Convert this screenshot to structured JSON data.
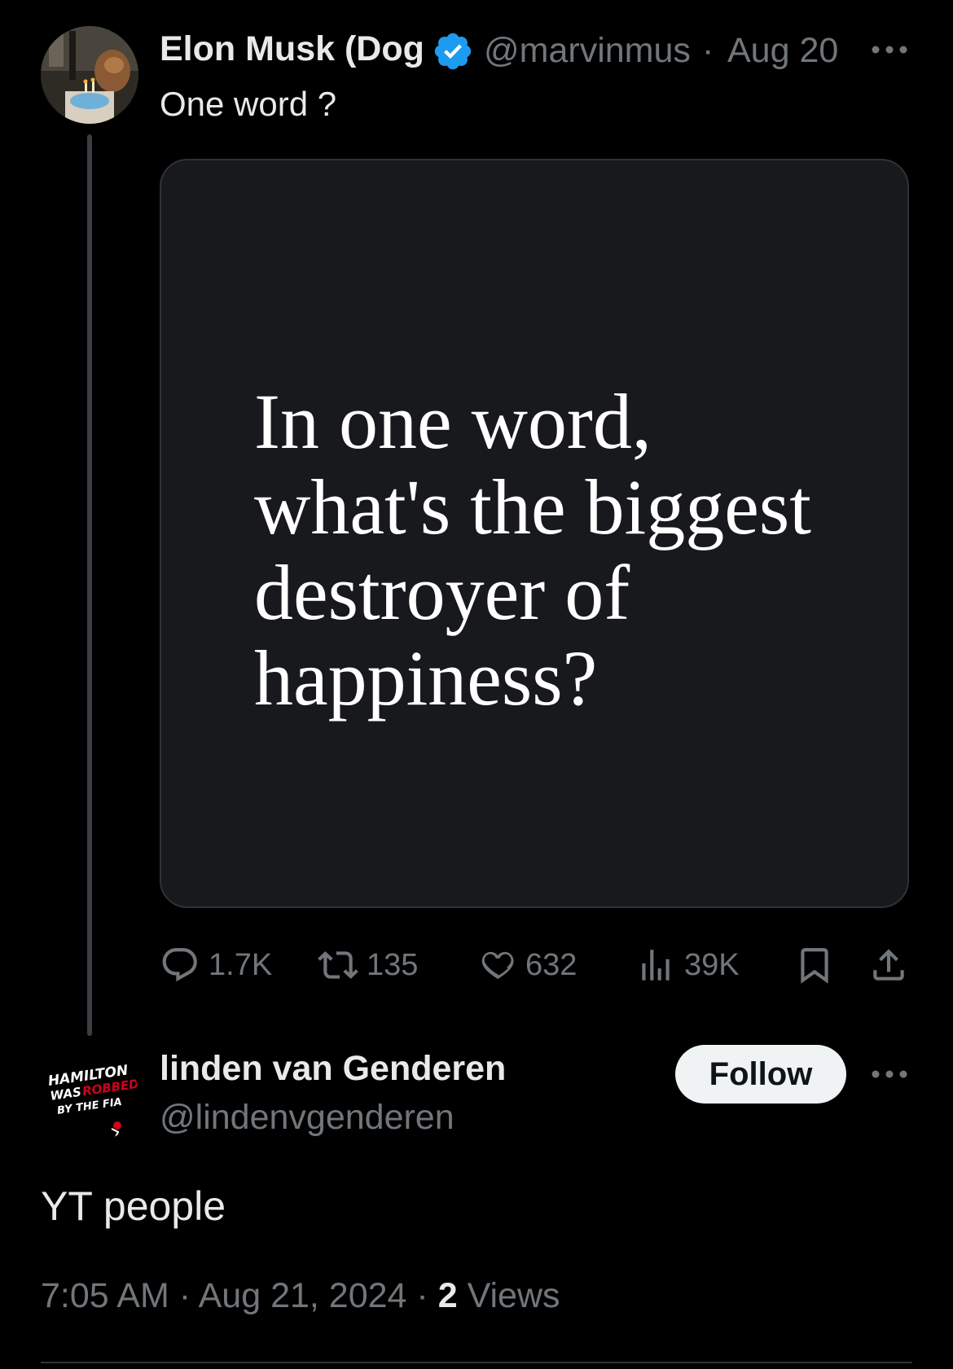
{
  "tweet": {
    "author_name": "Elon Musk (Dog",
    "handle": "@marvinmus",
    "date": "Aug 20",
    "separator": "·",
    "text": "One word ?",
    "image_text": "In one word,\nwhat's the biggest\ndestroyer of\nhappiness?",
    "stats": {
      "replies": "1.7K",
      "reposts": "135",
      "likes": "632",
      "views": "39K"
    }
  },
  "reply": {
    "author_name": "linden van Genderen",
    "handle": "@lindenvgenderen",
    "follow_label": "Follow",
    "avatar_text": [
      "HAMILTON",
      "WAS",
      "ROBBED",
      "BY THE FIA"
    ],
    "text": "YT people",
    "time": "7:05 AM",
    "date": "Aug 21, 2024",
    "views_count": "2",
    "views_label": "Views"
  },
  "colors": {
    "background": "#000000",
    "text": "#e7e9ea",
    "secondary": "#71767b",
    "verified": "#1d9bf0",
    "accent_red": "#d0021b"
  }
}
